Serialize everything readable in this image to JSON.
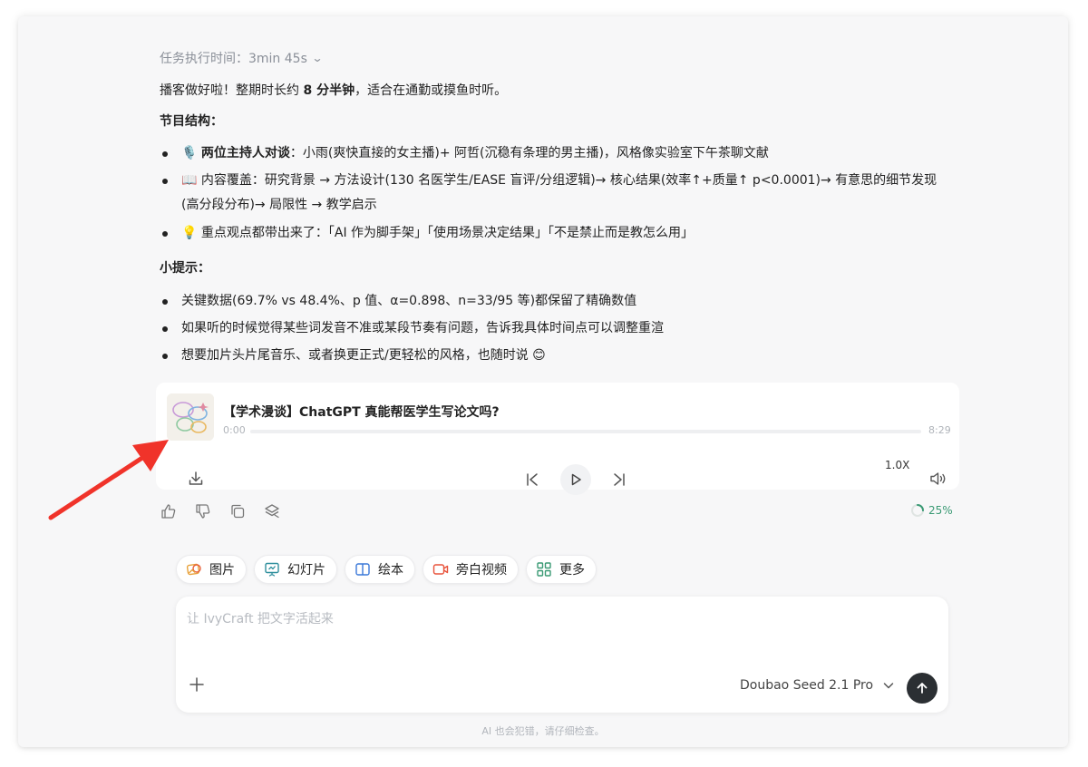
{
  "message": {
    "timer": "任务执行时间：3min 45s",
    "intro": {
      "before": "播客做好啦！整期时长约 ",
      "bold": "8 分半钟",
      "after": "，适合在通勤或摸鱼时听。"
    },
    "structure_heading": "节目结构：",
    "structure_items": [
      {
        "emoji": "🎙️",
        "bold": "两位主持人对谈",
        "text": "：小雨(爽快直接的女主播)+ 阿哲(沉稳有条理的男主播)，风格像实验室下午茶聊文献"
      },
      {
        "emoji": "📖",
        "text": " 内容覆盖：研究背景 → 方法设计(130 名医学生/EASE 盲评/分组逻辑)→ 核心结果(效率↑+质量↑ p<0.0001)→ 有意思的细节发现",
        "text2": "(高分段分布)→ 局限性 → 教学启示"
      },
      {
        "emoji": "💡",
        "text": " 重点观点都带出来了：「AI 作为脚手架」「使用场景决定结果」「不是禁止而是教怎么用」"
      }
    ],
    "tips_heading": "小提示：",
    "tips_items": [
      "关键数据(69.7% vs 48.4%、p 值、α=0.898、n=33/95 等)都保留了精确数值",
      "如果听的时候觉得某些词发音不准或某段节奏有问题，告诉我具体时间点可以调整重渲",
      "想要加片头片尾音乐、或者换更正式/更轻松的风格，也随时说 😊"
    ]
  },
  "player": {
    "title": "【学术漫谈】ChatGPT 真能帮医学生写论文吗?",
    "current_time": "0:00",
    "duration": "8:29",
    "speed": "1.0X",
    "progress_fraction": 0
  },
  "generation": {
    "progress_text": "25%",
    "progress_fraction": 0.25
  },
  "chips": [
    {
      "label": "图片",
      "icon": "image-icon"
    },
    {
      "label": "幻灯片",
      "icon": "slides-icon"
    },
    {
      "label": "绘本",
      "icon": "book-icon"
    },
    {
      "label": "旁白视频",
      "icon": "video-icon"
    },
    {
      "label": "更多",
      "icon": "grid-icon"
    }
  ],
  "composer": {
    "placeholder": "让 IvyCraft 把文字活起来",
    "model": "Doubao Seed 2.1 Pro"
  },
  "disclaimer": "AI 也会犯错，请仔细检查。",
  "colors": {
    "accent_green": "#3a9a74",
    "send_bg": "#2b2f33",
    "annotation_arrow": "#f0332a"
  }
}
